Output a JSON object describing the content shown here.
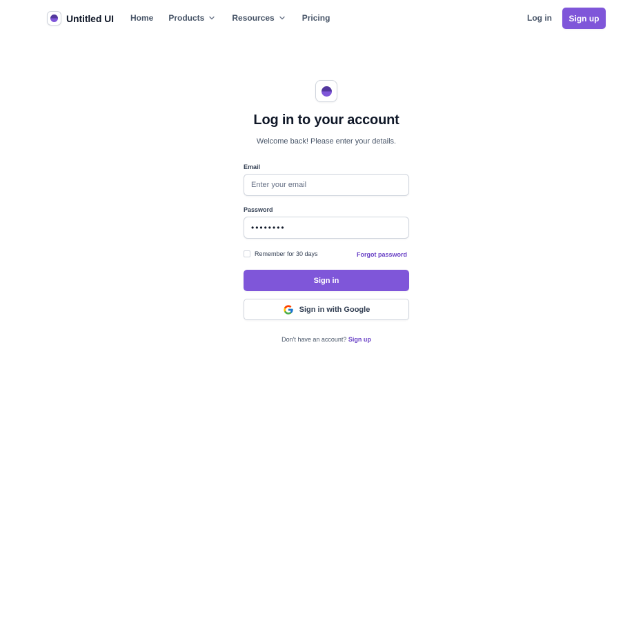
{
  "header": {
    "brand_name": "Untitled UI",
    "nav": [
      {
        "label": "Home"
      },
      {
        "label": "Products"
      },
      {
        "label": "Resources"
      },
      {
        "label": "Pricing"
      }
    ],
    "login_label": "Log in",
    "signup_label": "Sign up"
  },
  "login": {
    "title": "Log in to your account",
    "subtitle": "Welcome back! Please enter your details.",
    "email_label": "Email",
    "email_placeholder": "Enter your email",
    "email_value": "",
    "password_label": "Password",
    "password_value": "••••••••",
    "remember_label": "Remember for 30 days",
    "remember_checked": false,
    "forgot_label": "Forgot password",
    "signin_label": "Sign in",
    "google_label": "Sign in with Google",
    "footer_prompt": "Don't have an account?",
    "footer_link": "Sign up"
  },
  "colors": {
    "primary": "#7f56d9",
    "primary_text": "#6941c6",
    "border": "#d0d5dd",
    "heading": "#101828",
    "body": "#475467"
  },
  "icons": {
    "brand_logo": "purple-circle-logo-icon",
    "chevron": "chevron-down-icon",
    "google": "google-g-icon"
  }
}
